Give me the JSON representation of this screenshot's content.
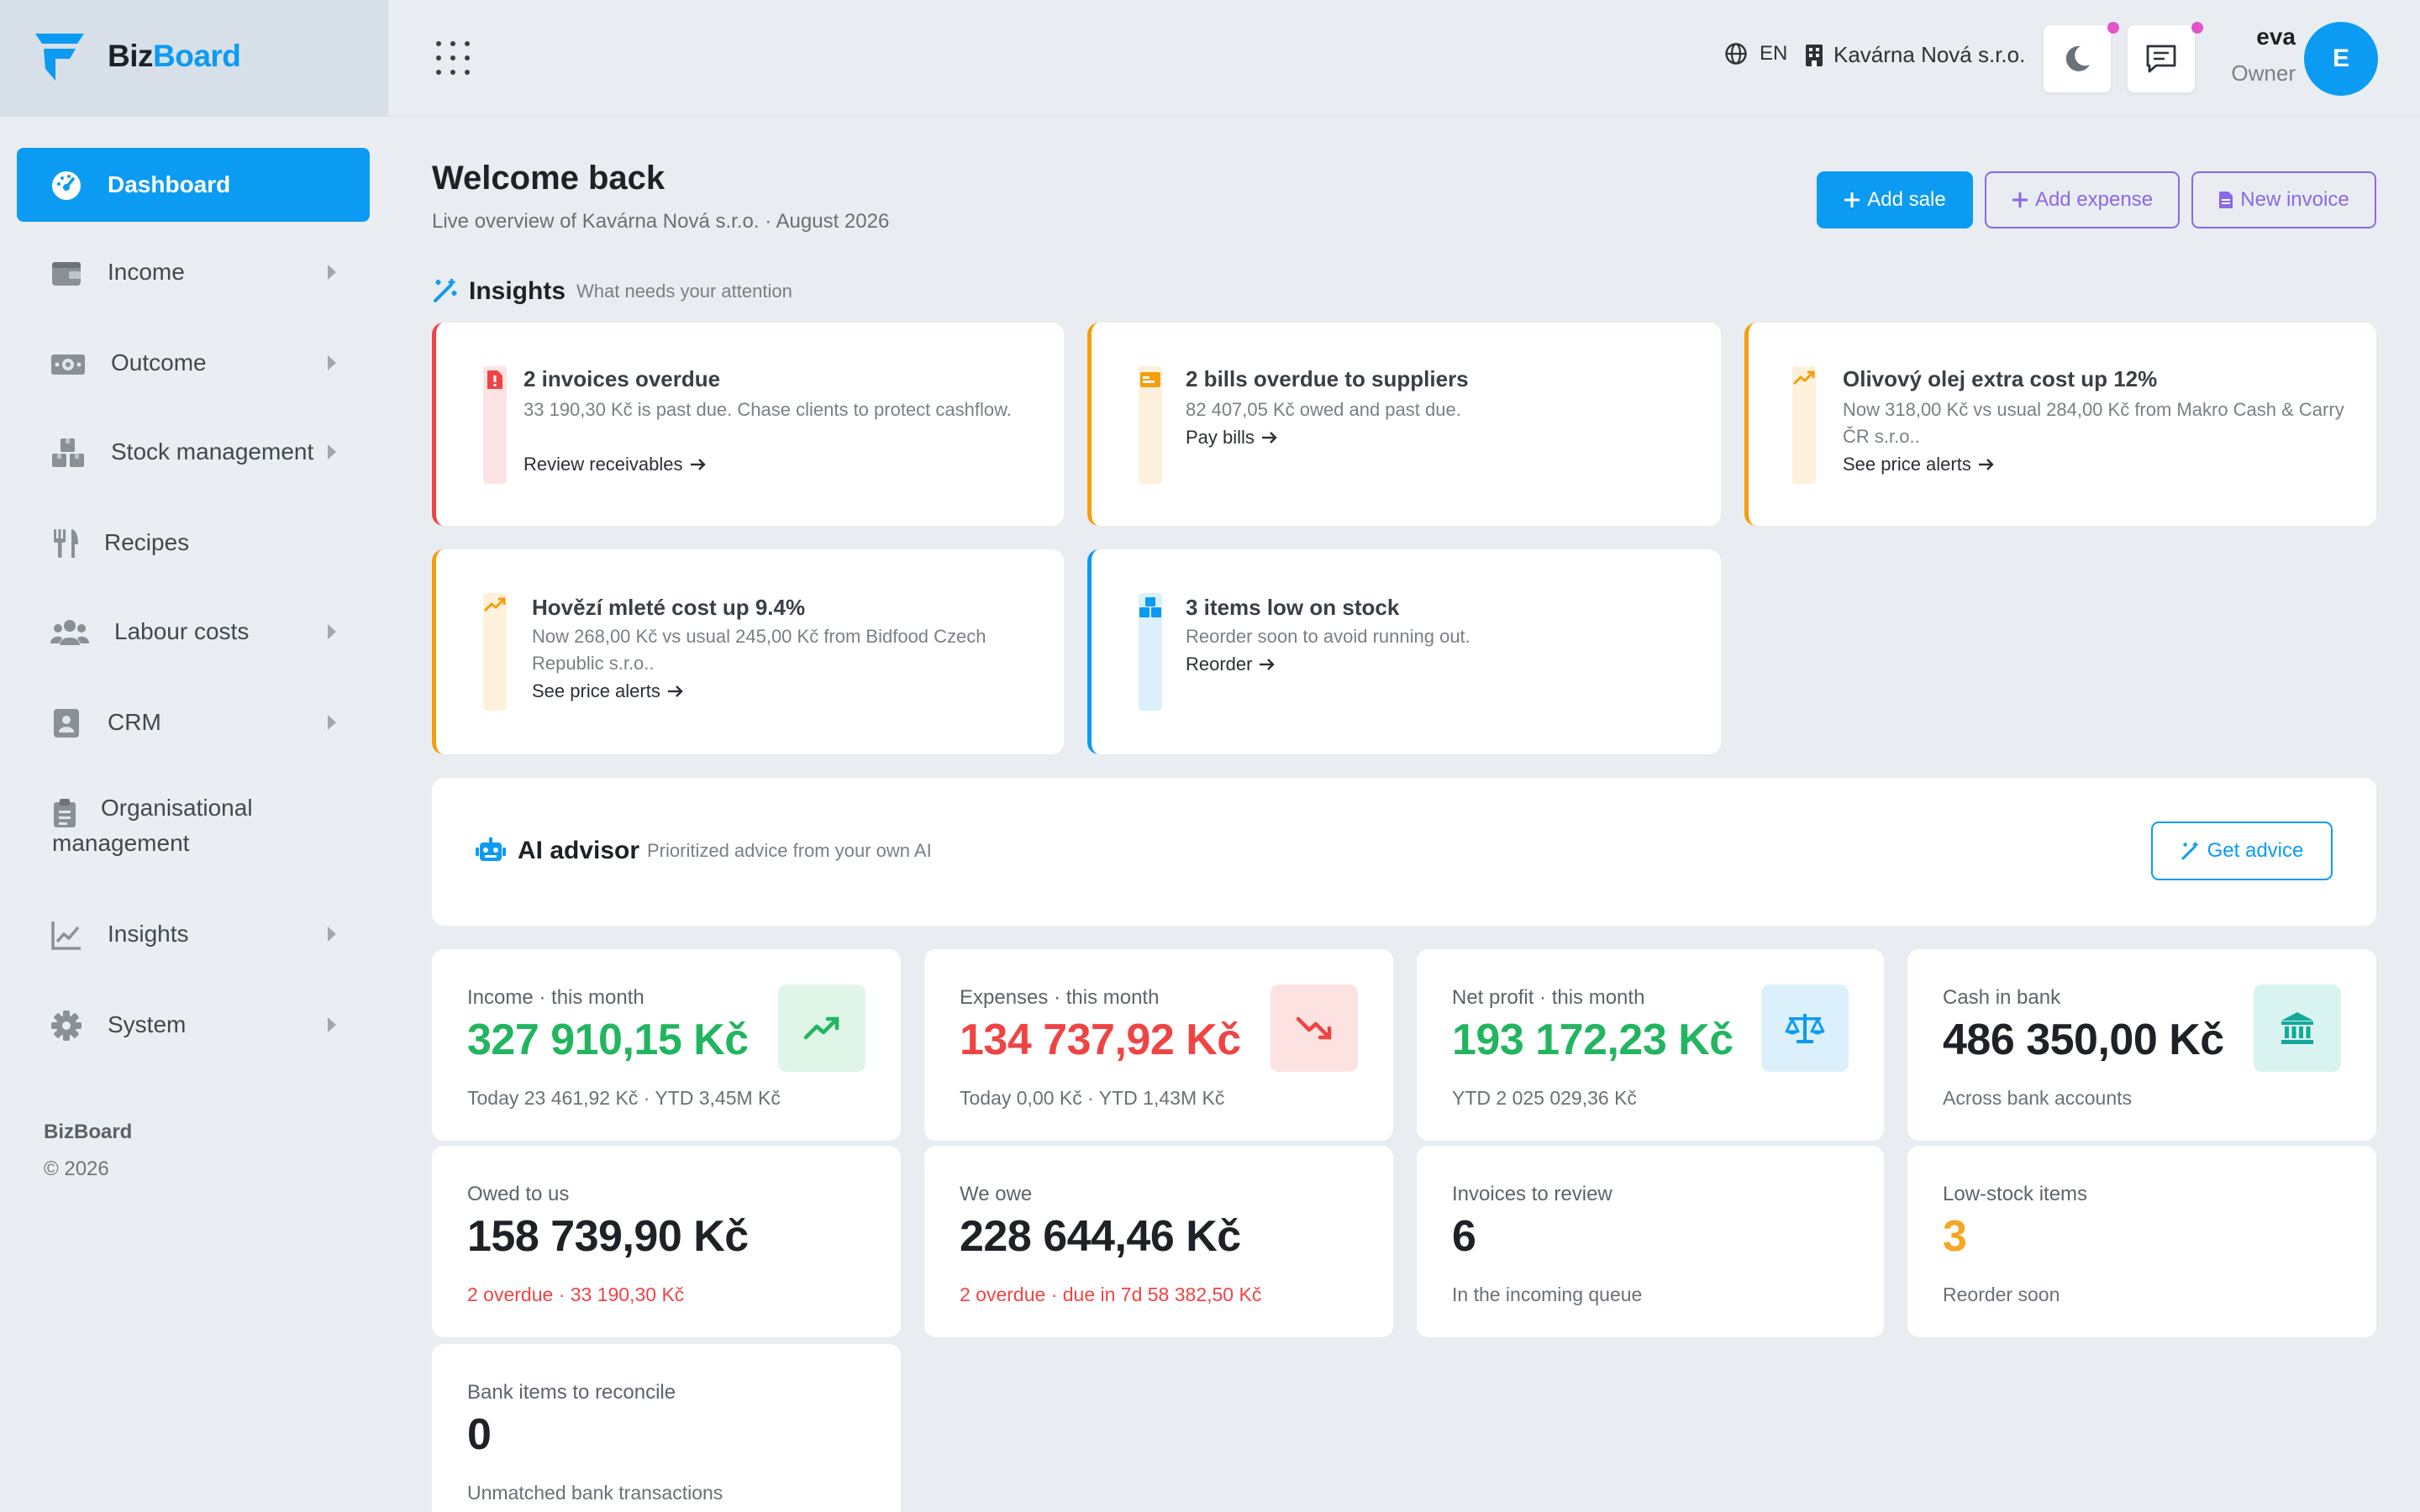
{
  "brand": {
    "name_part1": "Biz",
    "name_part2": "Board",
    "accent": "#0c9bf2"
  },
  "topbar": {
    "language": "EN",
    "company": "Kavárna Nová s.r.o.",
    "user_name": "eva",
    "user_role": "Owner",
    "avatar_initial": "E",
    "notification_dot_color": "#e255c8"
  },
  "sidebar": {
    "items": [
      {
        "label": "Dashboard",
        "icon": "dashboard-gauge-icon",
        "active": true
      },
      {
        "label": "Income",
        "icon": "wallet-icon",
        "has_children": true
      },
      {
        "label": "Outcome",
        "icon": "cash-icon",
        "has_children": true
      },
      {
        "label": "Stock management",
        "icon": "boxes-icon",
        "has_children": true
      },
      {
        "label": "Recipes",
        "icon": "utensils-icon",
        "has_children": false
      },
      {
        "label": "Labour costs",
        "icon": "users-icon",
        "has_children": true
      },
      {
        "label": "CRM",
        "icon": "contact-card-icon",
        "has_children": true
      },
      {
        "label_line1": "Organisational",
        "label_line2": "management",
        "icon": "clipboard-icon",
        "has_children": false
      },
      {
        "label": "Insights",
        "icon": "line-chart-icon",
        "has_children": true
      },
      {
        "label": "System",
        "icon": "gear-icon",
        "has_children": true
      }
    ],
    "footer_brand": "BizBoard",
    "footer_copyright": "© 2026"
  },
  "header": {
    "title": "Welcome back",
    "subtitle": "Live overview of Kavárna Nová s.r.o. · August 2026",
    "buttons": {
      "add_sale": "Add sale",
      "add_expense": "Add expense",
      "new_invoice": "New invoice"
    }
  },
  "insights": {
    "title": "Insights",
    "subtitle": "What needs your attention",
    "cards": [
      {
        "title": "2 invoices overdue",
        "desc": "33 190,30 Kč is past due. Chase clients to protect cashflow.",
        "link": "Review receivables",
        "color": "#ef4444",
        "icon": "invoice-alert-icon"
      },
      {
        "title": "2 bills overdue to suppliers",
        "desc": "82 407,05 Kč owed and past due.",
        "link": "Pay bills",
        "color": "#f59e0b",
        "icon": "bill-icon"
      },
      {
        "title": "Olivový olej extra cost up 12%",
        "desc": "Now 318,00 Kč vs usual 284,00 Kč from Makro Cash & Carry ČR s.r.o..",
        "link": "See price alerts",
        "color": "#f59e0b",
        "icon": "trend-up-icon"
      },
      {
        "title": "Hovězí mleté cost up 9.4%",
        "desc": "Now 268,00 Kč vs usual 245,00 Kč from Bidfood Czech Republic s.r.o..",
        "link": "See price alerts",
        "color": "#f59e0b",
        "icon": "trend-up-icon"
      },
      {
        "title": "3 items low on stock",
        "desc": "Reorder soon to avoid running out.",
        "link": "Reorder",
        "color": "#0c9bf2",
        "icon": "boxes-icon"
      }
    ]
  },
  "ai_advisor": {
    "title": "AI advisor",
    "subtitle": "Prioritized advice from your own AI",
    "button": "Get advice"
  },
  "stats": [
    {
      "label": "Income · this month",
      "value": "327 910,15 Kč",
      "sub": "Today 23 461,92 Kč · YTD 3,45M Kč",
      "value_color": "#22b55f",
      "icon": "trend-up-icon",
      "icon_bg": "#dff5e8",
      "icon_color": "#22b55f"
    },
    {
      "label": "Expenses · this month",
      "value": "134 737,92 Kč",
      "sub": "Today 0,00 Kč · YTD 1,43M Kč",
      "value_color": "#ef4444",
      "icon": "trend-down-icon",
      "icon_bg": "#fde2e2",
      "icon_color": "#ef4444"
    },
    {
      "label": "Net profit · this month",
      "value": "193 172,23 Kč",
      "sub": "YTD 2 025 029,36 Kč",
      "value_color": "#22b55f",
      "icon": "scale-icon",
      "icon_bg": "#dcf0fc",
      "icon_color": "#0c9bf2"
    },
    {
      "label": "Cash in bank",
      "value": "486 350,00 Kč",
      "sub": "Across bank accounts",
      "value_color": "#1e2126",
      "icon": "bank-icon",
      "icon_bg": "#d9f3f0",
      "icon_color": "#14a89a"
    },
    {
      "label": "Owed to us",
      "value": "158 739,90 Kč",
      "sub": "2 overdue · 33 190,30 Kč",
      "value_color": "#1e2126",
      "sub_color": "#ef4444"
    },
    {
      "label": "We owe",
      "value": "228 644,46 Kč",
      "sub": "2 overdue · due in 7d 58 382,50 Kč",
      "value_color": "#1e2126",
      "sub_color": "#ef4444"
    },
    {
      "label": "Invoices to review",
      "value": "6",
      "sub": "In the incoming queue",
      "value_color": "#1e2126"
    },
    {
      "label": "Low-stock items",
      "value": "3",
      "sub": "Reorder soon",
      "value_color": "#f5a623"
    },
    {
      "label": "Bank items to reconcile",
      "value": "0",
      "sub": "Unmatched bank transactions",
      "value_color": "#1e2126"
    }
  ]
}
